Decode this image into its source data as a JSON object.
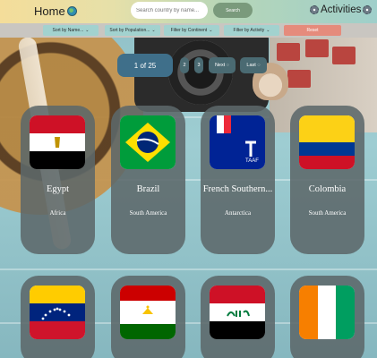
{
  "header": {
    "home_label": "Home",
    "search_placeholder": "Search country by name...",
    "search_button": "Search",
    "activities_label": "Activities"
  },
  "filters": {
    "sort_name": "Sort by Name...",
    "sort_population": "Sort by Population...",
    "filter_continent": "Filter by Continent",
    "filter_activity": "Filter by Activity",
    "reset": "Reset"
  },
  "pagination": {
    "indicator": "1 of 25",
    "page2": "2",
    "page3": "3",
    "next": "Next",
    "last": "Last"
  },
  "countries": [
    {
      "name": "Egypt",
      "region": "Africa"
    },
    {
      "name": "Brazil",
      "region": "South America"
    },
    {
      "name": "French Southern...",
      "region": "Antarctica"
    },
    {
      "name": "Colombia",
      "region": "South America"
    },
    {
      "name": "Venezuela",
      "region": ""
    },
    {
      "name": "Tajikistan",
      "region": ""
    },
    {
      "name": "Iraq",
      "region": ""
    },
    {
      "name": "Ivory Coast",
      "region": ""
    }
  ],
  "colors": {
    "card": "#5c686a",
    "reset": "#e58b7c",
    "filter": "#a2d2cf",
    "pager": "#3f6f8a"
  }
}
